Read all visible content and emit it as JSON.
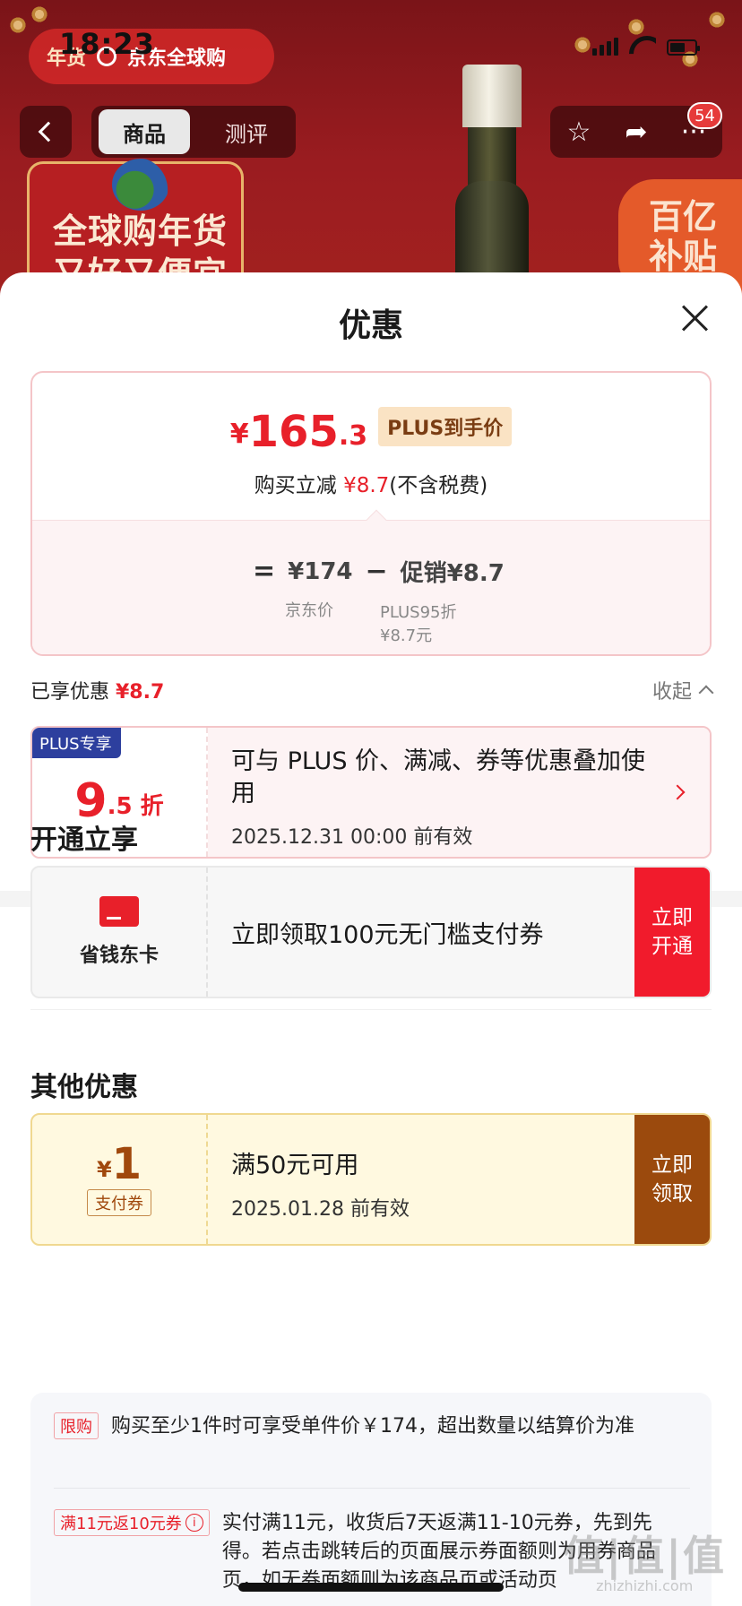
{
  "status_bar": {
    "time": "18:23"
  },
  "header": {
    "badge_mark": "年货",
    "store_name": "京东全球购",
    "tabs": [
      {
        "label": "商品",
        "active": true
      },
      {
        "label": "测评",
        "active": false
      }
    ],
    "cart_count": "54",
    "icons": [
      "back-arrow-icon",
      "star-icon",
      "share-icon",
      "more-icon"
    ]
  },
  "banner": {
    "left_line1": "全球购年货",
    "left_line2": "又好又便宜",
    "right_line1": "百亿",
    "right_line2": "补贴"
  },
  "sheet": {
    "title": "优惠",
    "price": {
      "currency": "¥",
      "integer": "165",
      "decimal": ".3",
      "tag": "PLUS到手价",
      "save_prefix": "购买立减 ",
      "save_amount": "¥8.7",
      "save_suffix": "(不含税费)",
      "eq": "=",
      "jd_price": "¥174",
      "minus": "−",
      "promo_label": "促销¥8.7",
      "jd_price_label": "京东价",
      "promo_sub1": "PLUS95折",
      "promo_sub2": "¥8.7元"
    },
    "enjoyed": {
      "label": "已享优惠 ",
      "amount": "¥8.7",
      "collapse": "收起"
    },
    "plus_coupon": {
      "flag": "PLUS专享",
      "rate_big": "9",
      "rate_small": ".5 折",
      "desc": "可与 PLUS 价、满减、券等优惠叠加使用",
      "valid": "2025.12.31 00:00 前有效"
    },
    "section_open": "开通立享",
    "card_offer": {
      "card_name": "省钱东卡",
      "desc": "立即领取100元无门槛支付券",
      "action_line1": "立即",
      "action_line2": "开通"
    },
    "section_other": "其他优惠",
    "pay_coupon": {
      "currency": "¥",
      "amount": "1",
      "tag": "支付券",
      "condition": "满50元可用",
      "valid": "2025.01.28 前有效",
      "action_line1": "立即",
      "action_line2": "领取"
    },
    "rules": [
      {
        "tag": "限购",
        "text": "购买至少1件时可享受单件价￥174，超出数量以结算价为准"
      },
      {
        "tag": "满11元返10元券",
        "text": "实付满11元，收货后7天返满11-10元券，先到先得。若点击跳转后的页面展示券面额则为用券商品页，如无券面额则为该商品页或活动页"
      }
    ]
  },
  "watermark": {
    "big": "值|值|值",
    "small": "zhizhizhi.com"
  },
  "colors": {
    "accent_red": "#e8202a",
    "plus_blue": "#2d3f9e",
    "coupon_brown": "#9b4a0d",
    "open_red": "#f11b2c"
  }
}
